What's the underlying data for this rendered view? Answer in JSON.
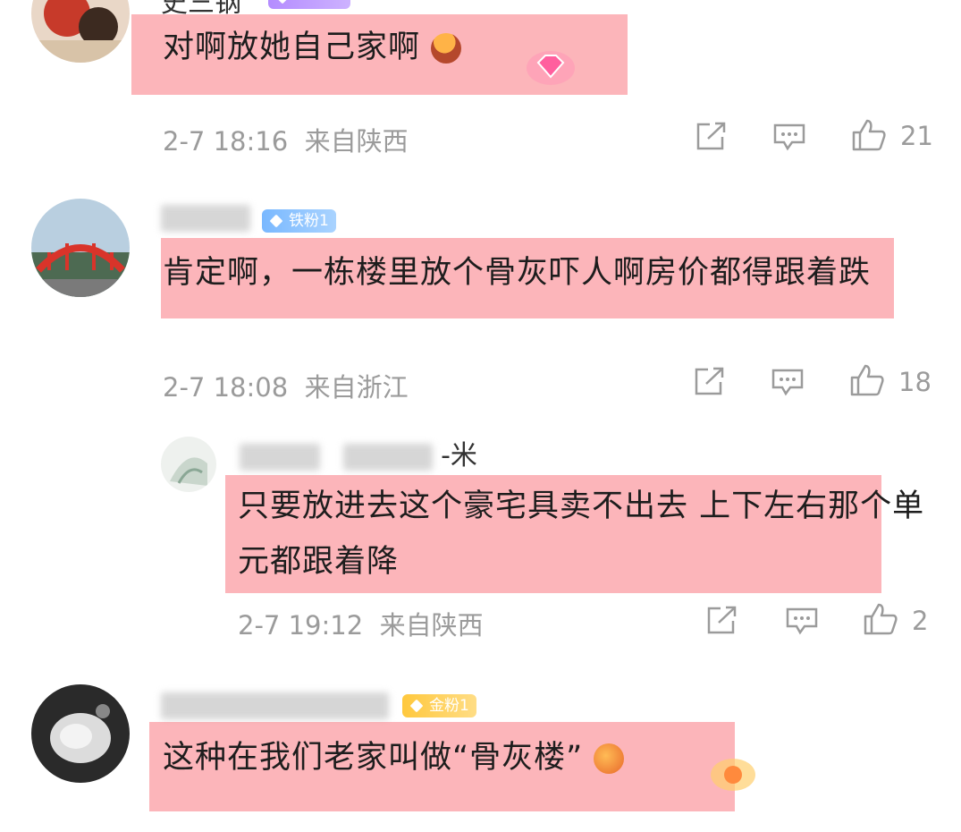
{
  "comments": [
    {
      "username_visible": "史三钢",
      "badge": "",
      "text": "对啊放她自己家啊",
      "time": "2-7 18:16",
      "location": "来自陕西",
      "likes": "21"
    },
    {
      "username_visible": "",
      "badge": "铁粉1",
      "text": "肯定啊，一栋楼里放个骨灰吓人啊房价都得跟着跌",
      "time": "2-7 18:08",
      "location": "来自浙江",
      "likes": "18"
    },
    {
      "username_visible": "-米",
      "badge": "",
      "text": "只要放进去这个豪宅具卖不出去 上下左右那个单元都跟着降",
      "time": "2-7 19:12",
      "location": "来自陕西",
      "likes": "2"
    },
    {
      "username_visible": "",
      "badge": "金粉1",
      "text": "这种在我们老家叫做“骨灰楼”",
      "time": "",
      "location": "",
      "likes": ""
    }
  ],
  "icons": {
    "share": "share-icon",
    "comment": "comment-icon",
    "like": "thumbs-up-icon"
  },
  "colors": {
    "highlight": "#f7838c",
    "meta": "#9b9b9b",
    "iron_badge": "#79b8ff",
    "gold_badge": "#ffc83d"
  }
}
